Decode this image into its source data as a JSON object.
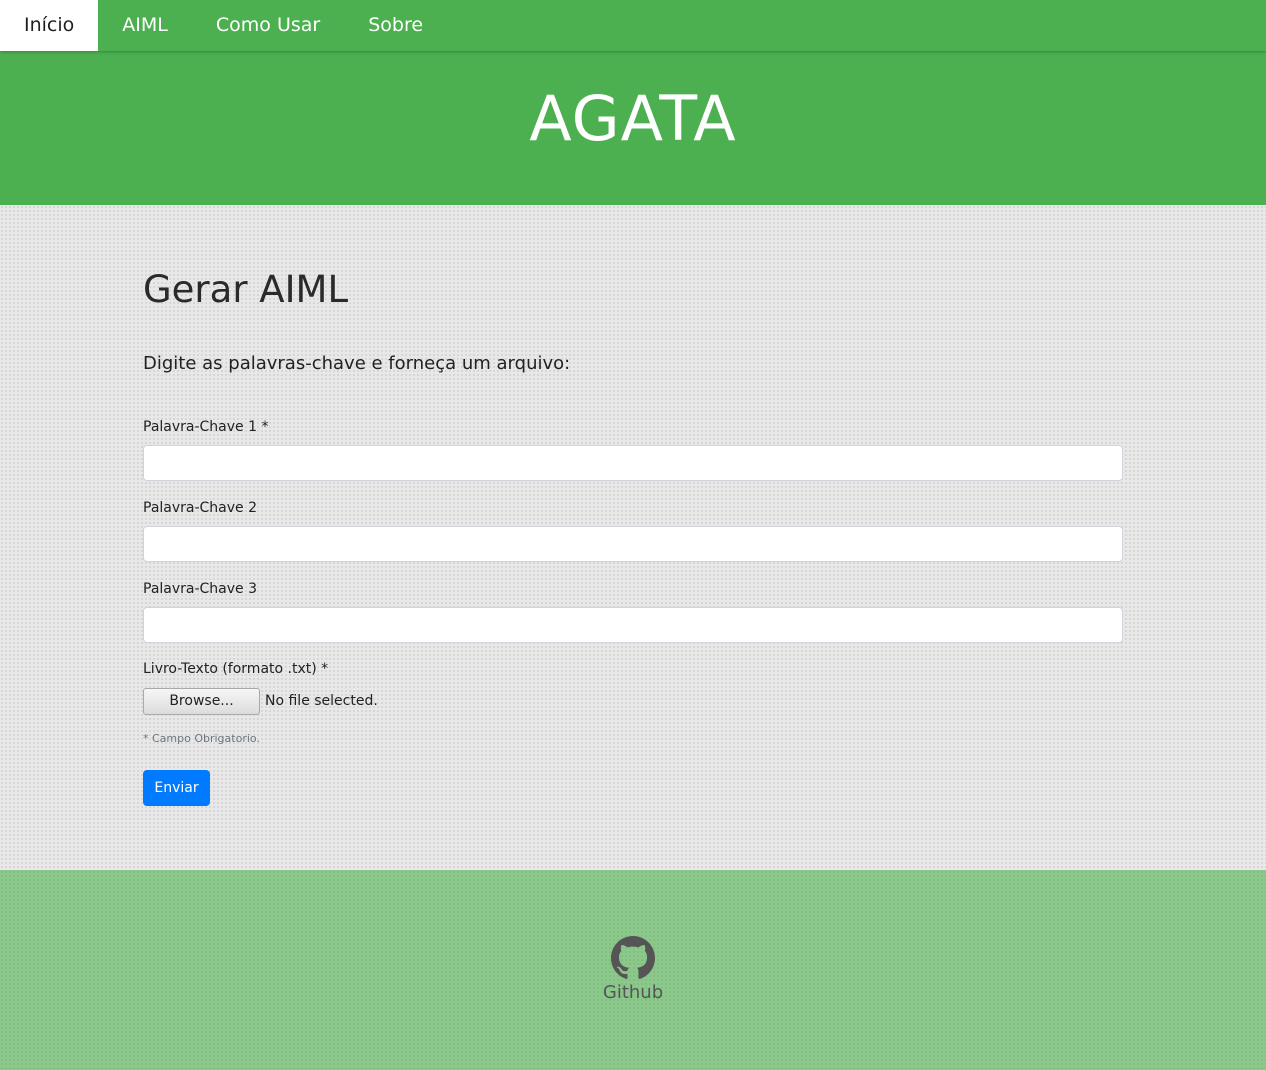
{
  "nav": {
    "items": [
      {
        "label": "Início"
      },
      {
        "label": "AIML"
      },
      {
        "label": "Como Usar"
      },
      {
        "label": "Sobre"
      }
    ]
  },
  "hero": {
    "title": "AGATA"
  },
  "form": {
    "title": "Gerar AIML",
    "lead": "Digite as palavras-chave e forneça um arquivo:",
    "keyword1_label": "Palavra-Chave 1 *",
    "keyword1_value": "",
    "keyword2_label": "Palavra-Chave 2",
    "keyword2_value": "",
    "keyword3_label": "Palavra-Chave 3",
    "keyword3_value": "",
    "file_label": "Livro-Texto (formato .txt) *",
    "browse_label": "Browse...",
    "file_status": "No file selected.",
    "required_note": "* Campo Obrigatorio.",
    "submit_label": "Enviar"
  },
  "footer": {
    "github_label": "Github",
    "icon": "github-icon"
  },
  "colors": {
    "brand": "#4caf50",
    "footer": "#8bc98b",
    "primary_button": "#007bff"
  }
}
